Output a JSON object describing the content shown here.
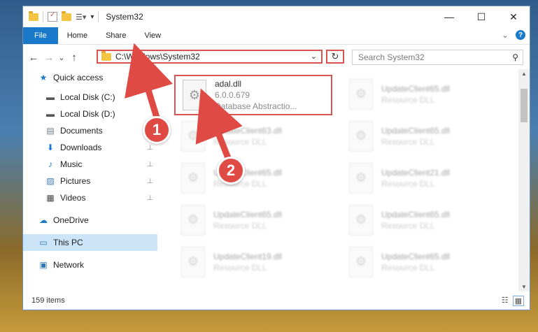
{
  "window": {
    "title": "System32",
    "controls": {
      "minimize": "—",
      "maximize": "☐",
      "close": "✕"
    }
  },
  "ribbon": {
    "tabs": [
      "File",
      "Home",
      "Share",
      "View"
    ],
    "expand_icon": "⌄",
    "help": "?"
  },
  "navbar": {
    "back": "←",
    "forward": "→",
    "recent": "⌄",
    "up": "↑",
    "address": "C:\\Windows\\System32",
    "search_placeholder": "Search System32",
    "refresh": "↻",
    "search_icon": "⚲"
  },
  "sidebar": {
    "items": [
      {
        "label": "Quick access",
        "icon": "★",
        "color": "#1979ca",
        "pinned": false
      },
      {
        "label": "Local Disk (C:)",
        "icon": "▬",
        "color": "#555555",
        "pinned": false
      },
      {
        "label": "Local Disk (D:)",
        "icon": "▬",
        "color": "#555555",
        "pinned": false
      },
      {
        "label": "Documents",
        "icon": "▤",
        "color": "#6a7a8a",
        "pinned": false
      },
      {
        "label": "Downloads",
        "icon": "⬇",
        "color": "#1979ca",
        "pinned": true
      },
      {
        "label": "Music",
        "icon": "♪",
        "color": "#1979ca",
        "pinned": true
      },
      {
        "label": "Pictures",
        "icon": "▨",
        "color": "#3c7ab8",
        "pinned": true
      },
      {
        "label": "Videos",
        "icon": "▦",
        "color": "#444444",
        "pinned": true
      },
      {
        "label": "OneDrive",
        "icon": "☁",
        "color": "#1979ca",
        "pinned": false
      },
      {
        "label": "This PC",
        "icon": "▭",
        "color": "#2a7ab8",
        "pinned": false,
        "selected": true
      },
      {
        "label": "Network",
        "icon": "▣",
        "color": "#2a7ab8",
        "pinned": false
      }
    ],
    "pin_icon": "📌"
  },
  "files": [
    {
      "name": "adal.dll",
      "line2": "6.0.0.679",
      "line3": "Database Abstractio...",
      "highlighted": true
    },
    {
      "name": "UpdateClient65.dll",
      "line2": "Resource DLL"
    },
    {
      "name": "UpdateClient63.dll",
      "line2": "Resource DLL"
    },
    {
      "name": "UpdateClient65.dll",
      "line2": "Resource DLL"
    },
    {
      "name": "UpdateClient65.dll",
      "line2": "Resource DLL"
    },
    {
      "name": "UpdateClient21.dll",
      "line2": "Resource DLL"
    },
    {
      "name": "UpdateClient65.dll",
      "line2": "Resource DLL"
    },
    {
      "name": "UpdateClient65.dll",
      "line2": "Resource DLL"
    },
    {
      "name": "UpdateClient19.dll",
      "line2": "Resource DLL"
    },
    {
      "name": "UpdateClient65.dll",
      "line2": "Resource DLL"
    }
  ],
  "status": {
    "count": "159 items"
  },
  "annotations": {
    "step1": "1",
    "step2": "2",
    "color": "#e04a45"
  }
}
